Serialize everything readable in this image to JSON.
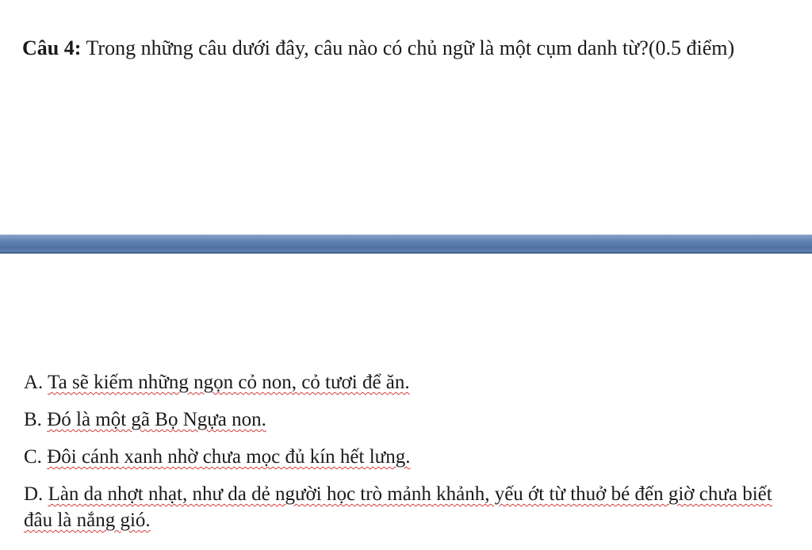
{
  "question": {
    "label": "Câu 4:",
    "text": "Trong những câu dưới đây, câu nào có chủ ngữ là một cụm danh từ?(0.5 điểm)"
  },
  "options": {
    "a": {
      "letter": "A.",
      "text": "Ta sẽ kiếm những ngọn cỏ non, cỏ tươi để ăn."
    },
    "b": {
      "letter": "B.",
      "text": "Đó là một gã Bọ Ngựa non."
    },
    "c": {
      "letter": "C.",
      "text": "Đôi cánh xanh nhờ chưa mọc đủ kín hết lưng."
    },
    "d": {
      "letter": "D.",
      "text": "Làn da nhợt nhạt, như da dẻ người học trò mảnh khảnh, yếu ớt từ thuở bé đến giờ chưa biết đâu là nắng gió."
    }
  },
  "colors": {
    "divider": "#5f82b0",
    "spellcheck_underline": "#d43a3a"
  }
}
